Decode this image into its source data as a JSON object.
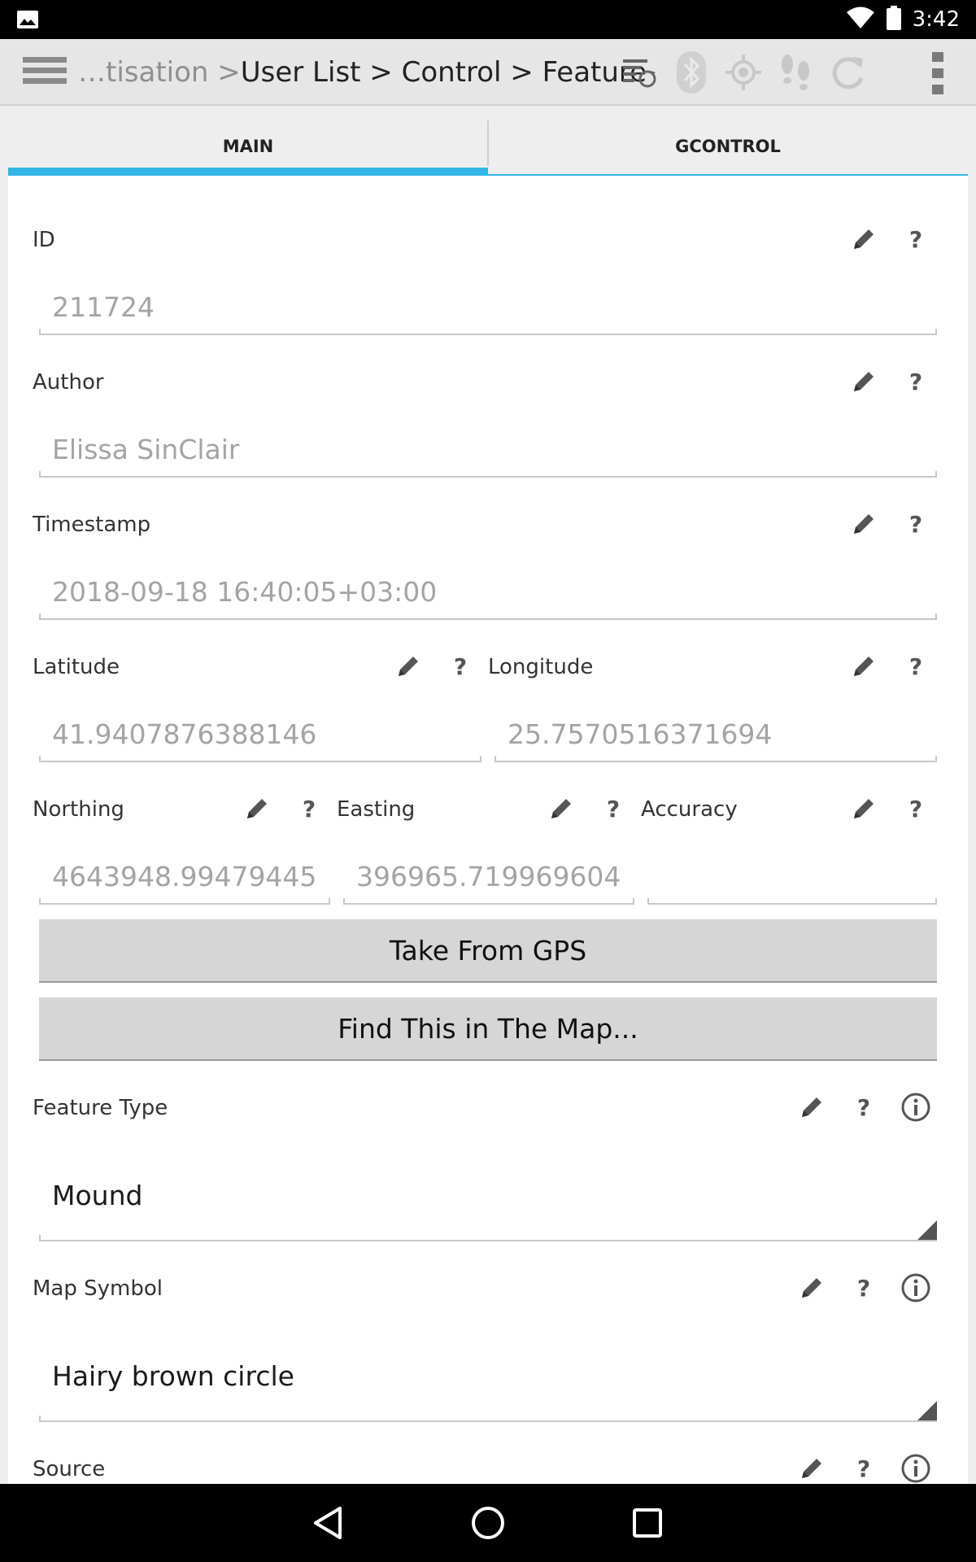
{
  "status_bar": {
    "time": "3:42"
  },
  "action_bar": {
    "breadcrumb_prefix": "…tisation > ",
    "breadcrumb_path": "User List > Control > Feature"
  },
  "tabs": [
    {
      "label": "MAIN",
      "active": true
    },
    {
      "label": "GCONTROL",
      "active": false
    }
  ],
  "fields": {
    "id": {
      "label": "ID",
      "value": "211724"
    },
    "author": {
      "label": "Author",
      "value": "Elissa SinClair"
    },
    "timestamp": {
      "label": "Timestamp",
      "value": "2018-09-18 16:40:05+03:00"
    },
    "latitude": {
      "label": "Latitude",
      "value": "41.9407876388146"
    },
    "longitude": {
      "label": "Longitude",
      "value": "25.7570516371694"
    },
    "northing": {
      "label": "Northing",
      "value": "4643948.99479445"
    },
    "easting": {
      "label": "Easting",
      "value": "396965.719969604"
    },
    "accuracy": {
      "label": "Accuracy",
      "value": ""
    },
    "feature_type": {
      "label": "Feature Type",
      "value": "Mound"
    },
    "map_symbol": {
      "label": "Map Symbol",
      "value": "Hairy brown circle"
    },
    "source": {
      "label": "Source"
    }
  },
  "buttons": {
    "take_from_gps": "Take From GPS",
    "find_in_map": "Find This in The Map..."
  },
  "help_glyph": "?",
  "colors": {
    "accent": "#33b5e5",
    "hint_text": "#a4a4a4",
    "button_bg": "#d6d6d6"
  }
}
